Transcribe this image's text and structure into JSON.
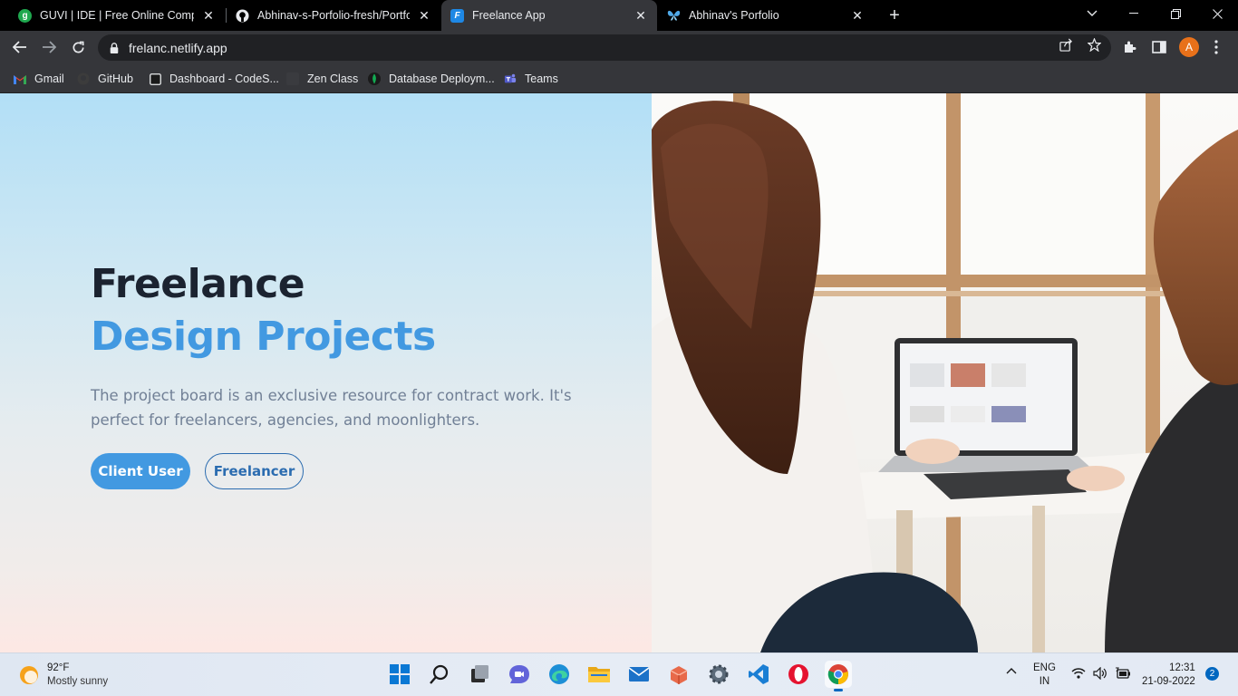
{
  "browser": {
    "tabs": [
      {
        "title": "GUVI | IDE | Free Online Compiler",
        "favicon_color": "#1fa84f",
        "favicon_text": "g",
        "active": false
      },
      {
        "title": "Abhinav-s-Porfolio-fresh/Portfolio",
        "favicon_color": "#1f1f1f",
        "favicon_text": "",
        "active": false
      },
      {
        "title": "Freelance App",
        "favicon_color": "#1e88e5",
        "favicon_text": "F",
        "active": true
      },
      {
        "title": "Abhinav's Porfolio",
        "favicon_color": "#4fa9e8",
        "favicon_text": "",
        "active": false
      }
    ],
    "url": "frelanc.netlify.app",
    "profile_initial": "A",
    "bookmarks": [
      {
        "label": "Gmail",
        "icon": "gmail-icon"
      },
      {
        "label": "GitHub",
        "icon": "github-icon"
      },
      {
        "label": "Dashboard - CodeS...",
        "icon": "dashboard-icon"
      },
      {
        "label": "Zen Class",
        "icon": "zen-class-icon"
      },
      {
        "label": "Database Deploym...",
        "icon": "mongodb-icon"
      },
      {
        "label": "Teams",
        "icon": "teams-icon"
      }
    ]
  },
  "hero": {
    "title": "Freelance",
    "subtitle": "Design Projects",
    "description": "The project board is an exclusive resource for contract work. It's perfect for freelancers, agencies, and moonlighters.",
    "primary_button": "Client User",
    "secondary_button": "Freelancer",
    "accent_color": "#4299e1"
  },
  "taskbar": {
    "weather_temp": "92°F",
    "weather_desc": "Mostly sunny",
    "language": "ENG",
    "region": "IN",
    "time": "12:31",
    "date": "21-09-2022",
    "notification_count": "2",
    "apps": [
      "start-icon",
      "search-icon",
      "task-view-icon",
      "chat-icon",
      "edge-icon",
      "file-explorer-icon",
      "mail-icon",
      "store-icon",
      "settings-icon",
      "vscode-icon",
      "opera-icon",
      "chrome-icon"
    ]
  }
}
